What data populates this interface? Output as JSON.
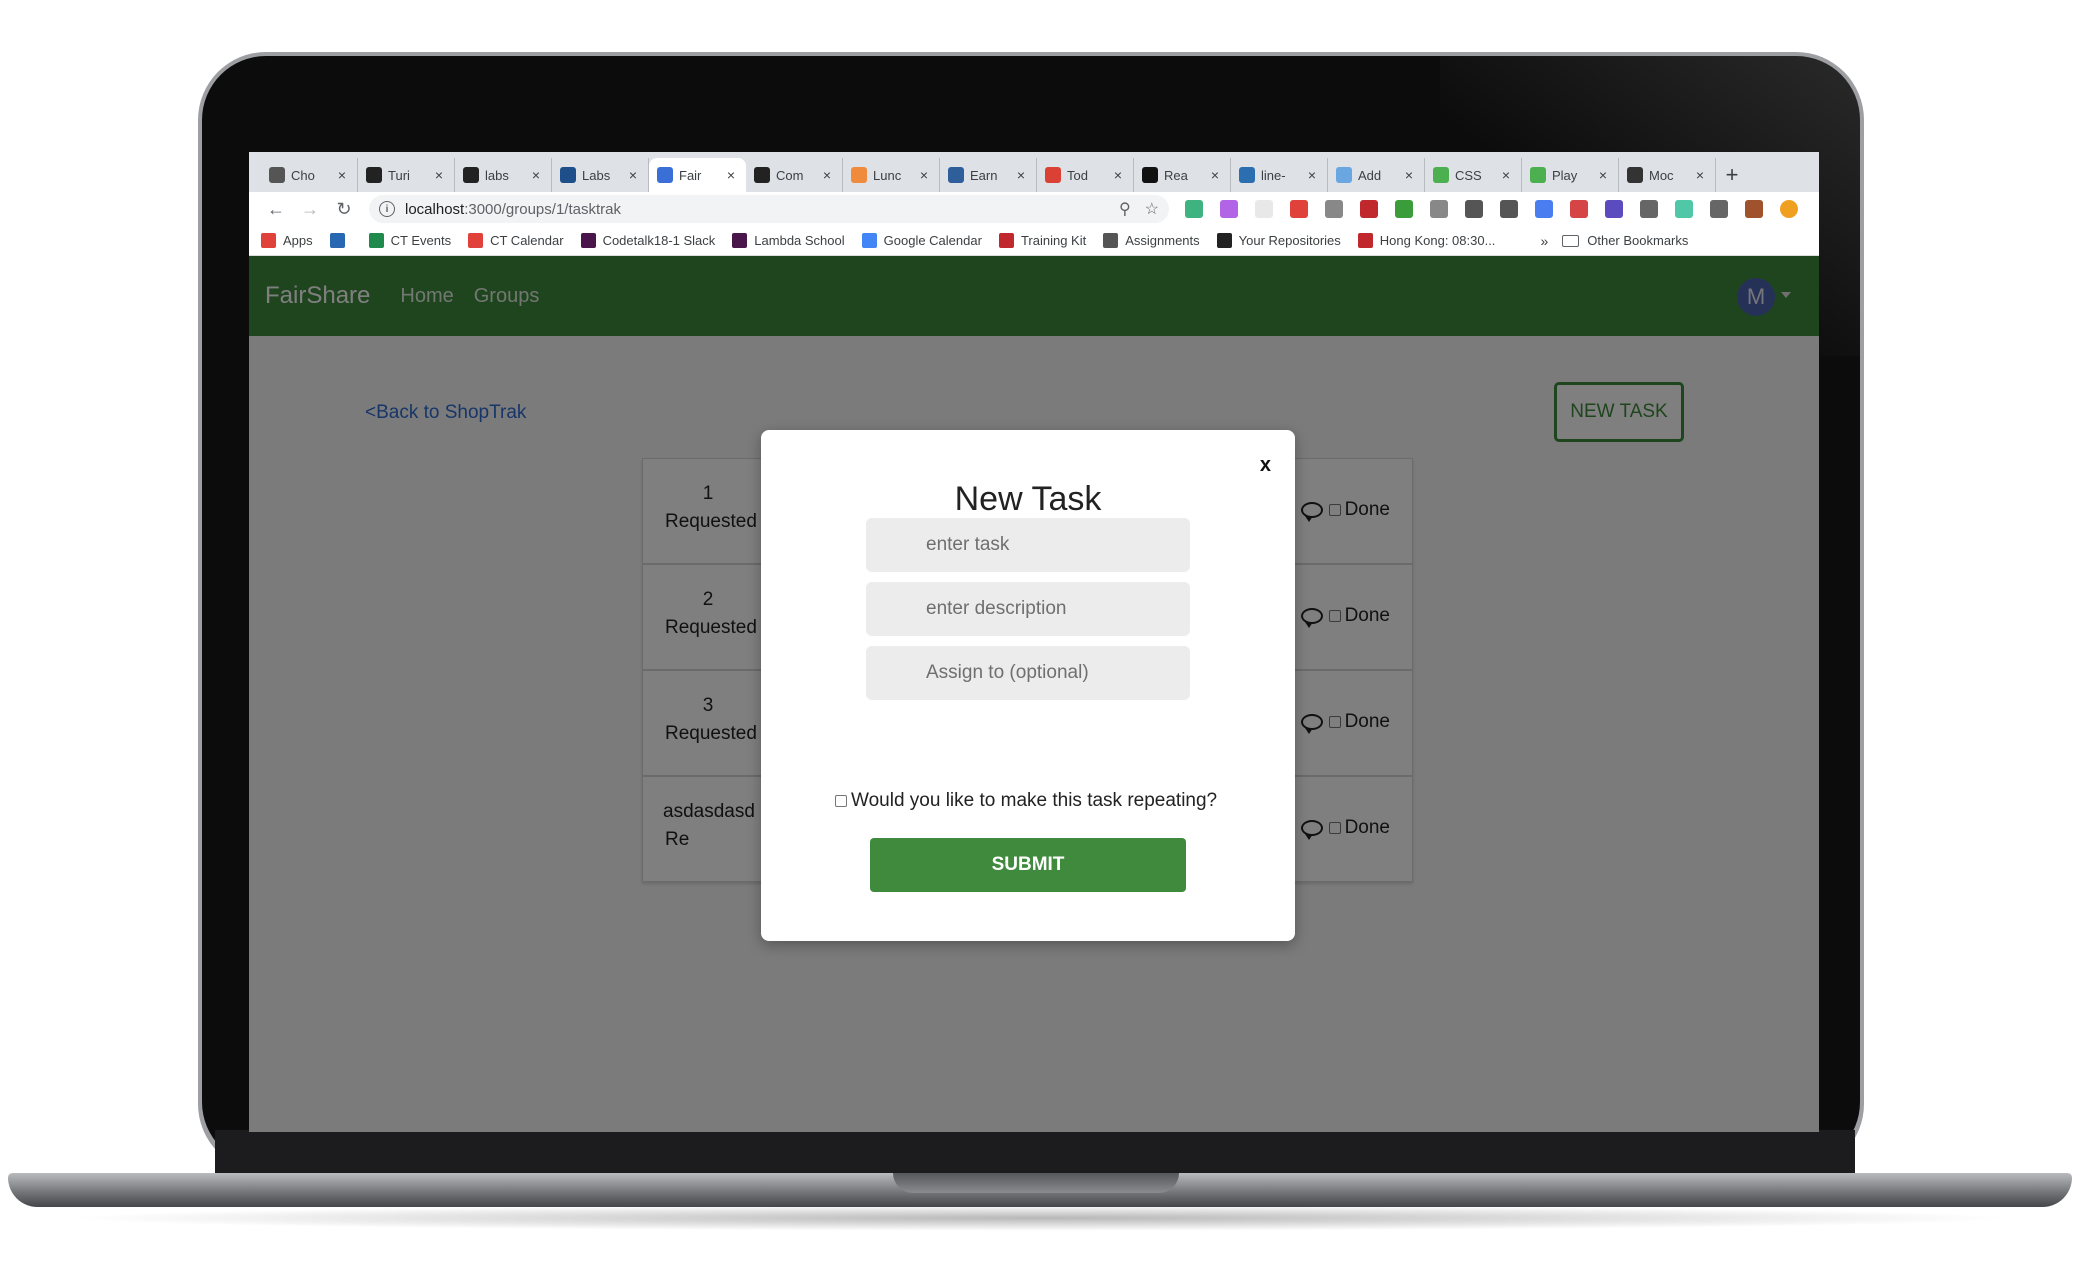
{
  "browser": {
    "tabs": [
      {
        "label": "Cho",
        "icon": "smiley-icon",
        "color": "#555555",
        "active": false
      },
      {
        "label": "Turi",
        "icon": "turing-icon",
        "color": "#222222",
        "active": false
      },
      {
        "label": "labs",
        "icon": "github-icon",
        "color": "#222222",
        "active": false
      },
      {
        "label": "Labs",
        "icon": "trello-icon",
        "color": "#1f4f8a",
        "active": false
      },
      {
        "label": "Fair",
        "icon": "fairshare-icon",
        "color": "#3b6fd8",
        "active": true
      },
      {
        "label": "Com",
        "icon": "github-icon",
        "color": "#222222",
        "active": false
      },
      {
        "label": "Lunc",
        "icon": "lunch-icon",
        "color": "#f08a3c",
        "active": false
      },
      {
        "label": "Earn",
        "icon": "g-icon",
        "color": "#2f5f9a",
        "active": false
      },
      {
        "label": "Tod",
        "icon": "todoist-icon",
        "color": "#db4035",
        "active": false
      },
      {
        "label": "Rea",
        "icon": "medium-icon",
        "color": "#111111",
        "active": false
      },
      {
        "label": "line-",
        "icon": "graduation-icon",
        "color": "#2c6fb0",
        "active": false
      },
      {
        "label": "Add",
        "icon": "dots-icon",
        "color": "#6aa6e0",
        "active": false
      },
      {
        "label": "CSS",
        "icon": "w3-icon",
        "color": "#4caf50",
        "active": false
      },
      {
        "label": "Play",
        "icon": "w3-icon",
        "color": "#4caf50",
        "active": false
      },
      {
        "label": "Moc",
        "icon": "p-icon",
        "color": "#333333",
        "active": false
      }
    ],
    "close_glyph": "×",
    "new_tab_glyph": "+",
    "url_prefix": "localhost",
    "url_path": ":3000/groups/1/tasktrak",
    "extensions": [
      "#3fb37f",
      "#b264e6",
      "#e8e8e8",
      "#e0413b",
      "#888888",
      "#c0282d",
      "#3a9d3a",
      "#888888",
      "#555555",
      "#555555",
      "#4a7ef0",
      "#d64545",
      "#5c4bbf",
      "#666666",
      "#50c8a8",
      "#666666",
      "#a0522d",
      "#f0a020"
    ],
    "bookmarks": [
      {
        "label": "Apps",
        "color": "#e0413b"
      },
      {
        "label": "",
        "color": "#2867b2"
      },
      {
        "label": "CT Events",
        "color": "#1f8a4c"
      },
      {
        "label": "CT Calendar",
        "color": "#e0413b"
      },
      {
        "label": "Codetalk18-1 Slack",
        "color": "#4a154b"
      },
      {
        "label": "Lambda School",
        "color": "#4a154b"
      },
      {
        "label": "Google Calendar",
        "color": "#4285f4"
      },
      {
        "label": "Training Kit",
        "color": "#c0282d"
      },
      {
        "label": "Assignments",
        "color": "#555555"
      },
      {
        "label": "Your Repositories",
        "color": "#222222"
      },
      {
        "label": "Hong Kong: 08:30...",
        "color": "#c0282d"
      }
    ],
    "more_glyph": "»",
    "other_bookmarks": "Other Bookmarks"
  },
  "app": {
    "brand": "FairShare",
    "nav": [
      "Home",
      "Groups"
    ],
    "avatar_letter": "M",
    "back_link": "Back to ShopTrak",
    "back_glyph": "<",
    "new_task_button": "NEW TASK",
    "tasks": [
      {
        "name": "1",
        "status": "Requested",
        "done_label": "Done"
      },
      {
        "name": "2",
        "status": "Requested",
        "done_label": "Done"
      },
      {
        "name": "3",
        "status": "Requested",
        "done_label": "Done"
      },
      {
        "name": "asdasdasd",
        "status": "Re",
        "done_label": "Done"
      }
    ]
  },
  "modal": {
    "close": "x",
    "title": "New Task",
    "task_placeholder": "enter task",
    "description_placeholder": "enter description",
    "assign_placeholder": "Assign to (optional)",
    "repeat_label": "Would you like to make this task repeating?",
    "submit": "SUBMIT"
  },
  "colors": {
    "nav_green": "#3f8a3d",
    "link_blue": "#2f6bd1",
    "avatar_blue": "#4d63b0"
  }
}
